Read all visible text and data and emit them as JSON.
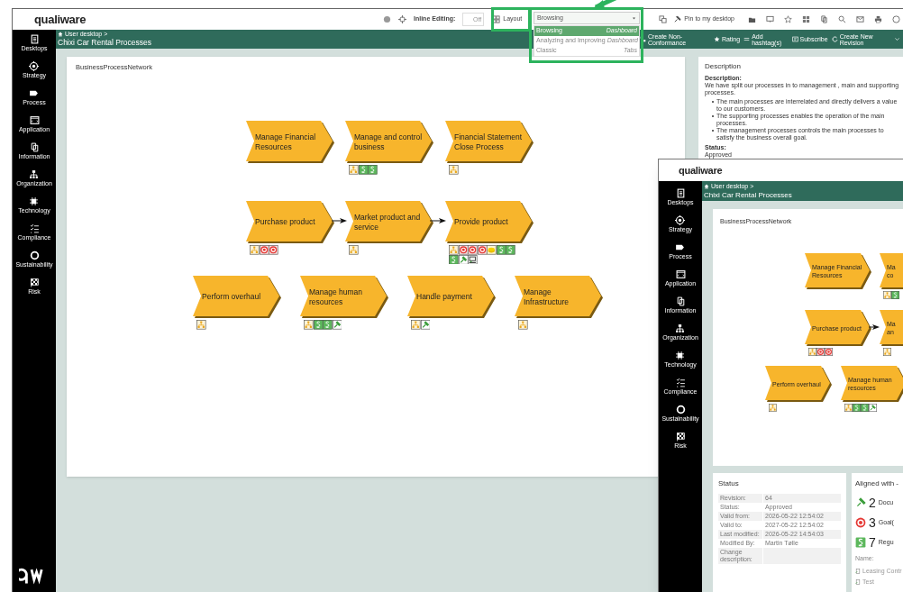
{
  "header": {
    "logo": "qualiware",
    "inline_editing_label": "Inline Editing:",
    "inline_editing_toggle": {
      "label": "Off",
      "on": false
    },
    "layout_label": "Layout",
    "layout_select": {
      "value": "Browsing",
      "options": [
        {
          "label": "Browsing",
          "hint": "Dashboard",
          "selected": true
        },
        {
          "label": "Analyzing and Improving",
          "hint": "Dashboard",
          "selected": false
        },
        {
          "label": "Classic",
          "hint": "Tabs",
          "selected": false
        }
      ]
    },
    "pin_label": "Pin to my desktop"
  },
  "breadcrumb": "User desktop >",
  "page_title": "Chixi Car Rental Processes",
  "actions": [
    {
      "kind": "nonconformance",
      "label": "Create Non-Conformance"
    },
    {
      "kind": "star",
      "label": "Rating"
    },
    {
      "kind": "hashtag",
      "label": "Add hashtag(s)"
    },
    {
      "kind": "subscribe",
      "label": "Subscribe"
    },
    {
      "kind": "revision",
      "label": "Create New Revision"
    }
  ],
  "sidebar": [
    {
      "kind": "desktop",
      "label": "Desktops"
    },
    {
      "kind": "strategy",
      "label": "Strategy"
    },
    {
      "kind": "process",
      "label": "Process"
    },
    {
      "kind": "application",
      "label": "Application"
    },
    {
      "kind": "information",
      "label": "Information"
    },
    {
      "kind": "organization",
      "label": "Organization"
    },
    {
      "kind": "technology",
      "label": "Technology"
    },
    {
      "kind": "compliance",
      "label": "Compliance"
    },
    {
      "kind": "sustainability",
      "label": "Sustainability"
    },
    {
      "kind": "risk",
      "label": "Risk"
    }
  ],
  "diagram": {
    "title": "BusinessProcessNetwork",
    "nodes": [
      {
        "label": "Manage Financial Resources"
      },
      {
        "label": "Manage and control business"
      },
      {
        "label": "Financial Statement Close Process"
      },
      {
        "label": "Purchase product"
      },
      {
        "label": "Market product and service"
      },
      {
        "label": "Provide product"
      },
      {
        "label": "Perform overhaul"
      },
      {
        "label": "Manage human resources"
      },
      {
        "label": "Handle payment"
      },
      {
        "label": "Manage Infrastructure"
      }
    ]
  },
  "description": {
    "title": "Description",
    "heading": "Description:",
    "text": "We have split our processes in to management , main and supporting processes.",
    "bullets": [
      "The main processes are interrelated and directly delivers a value to our customers.",
      "The supporting processes enables the operation of the main processes.",
      "The management processes controls the main processes to satisfy the business overall goal."
    ],
    "status_label": "Status:",
    "status_value": "Approved"
  },
  "overlay_window": {
    "logo": "qualiware",
    "breadcrumb": "User desktop >",
    "page_title": "Chixi Car Rental Processes",
    "sidebar": [
      {
        "kind": "desktop",
        "label": "Desktops"
      },
      {
        "kind": "strategy",
        "label": "Strategy"
      },
      {
        "kind": "process",
        "label": "Process"
      },
      {
        "kind": "application",
        "label": "Application"
      },
      {
        "kind": "information",
        "label": "Information"
      },
      {
        "kind": "organization",
        "label": "Organization"
      },
      {
        "kind": "technology",
        "label": "Technology"
      },
      {
        "kind": "compliance",
        "label": "Compliance"
      },
      {
        "kind": "sustainability",
        "label": "Sustainability"
      },
      {
        "kind": "risk",
        "label": "Risk"
      }
    ],
    "diagram": {
      "title": "BusinessProcessNetwork",
      "nodes": [
        {
          "label": "Manage Financial Resources"
        },
        {
          "label": "Ma\nco"
        },
        {
          "label": "Purchase product"
        },
        {
          "label": "Ma\nan"
        },
        {
          "label": "Perform overhaul"
        },
        {
          "label": "Manage human resources"
        }
      ]
    },
    "status": {
      "title": "Status",
      "rows": [
        {
          "label": "Revision:",
          "value": "64"
        },
        {
          "label": "Status:",
          "value": "Approved"
        },
        {
          "label": "Valid from:",
          "value": "2026-05-22 12:54:02"
        },
        {
          "label": "Valid to:",
          "value": "2027-05-22 12:54:02"
        },
        {
          "label": "Last modified:",
          "value": "2026-05-22 14:54:03"
        },
        {
          "label": "Modified By:",
          "value": "Martin Tølle"
        },
        {
          "label": "Change description:"
        }
      ]
    },
    "aligned": {
      "title": "Aligned with -",
      "counts": [
        {
          "kind": "doc",
          "count": "2",
          "label": "Docu"
        },
        {
          "kind": "goal",
          "count": "3",
          "label": "Goal("
        },
        {
          "kind": "reg",
          "count": "7",
          "label": "Regu"
        }
      ],
      "name_label": "Name:",
      "items": [
        "Leasing Contr",
        "Test"
      ]
    }
  }
}
